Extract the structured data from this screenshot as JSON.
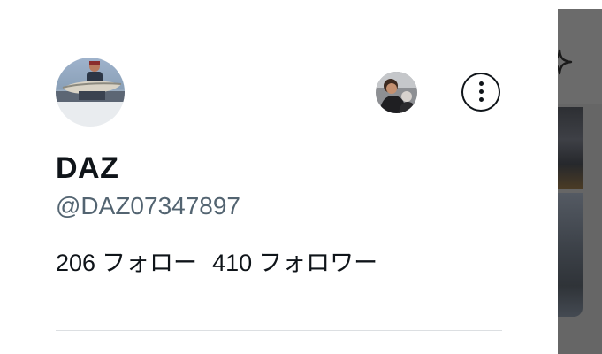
{
  "profile": {
    "display_name": "DAZ",
    "handle": "@DAZ07347897",
    "following_count": "206",
    "following_label": "フォロー",
    "followers_count": "410",
    "followers_label": "フォロワー"
  },
  "icons": {
    "more": "more-vertical-circle-icon",
    "sparkle": "sparkle-icon"
  }
}
